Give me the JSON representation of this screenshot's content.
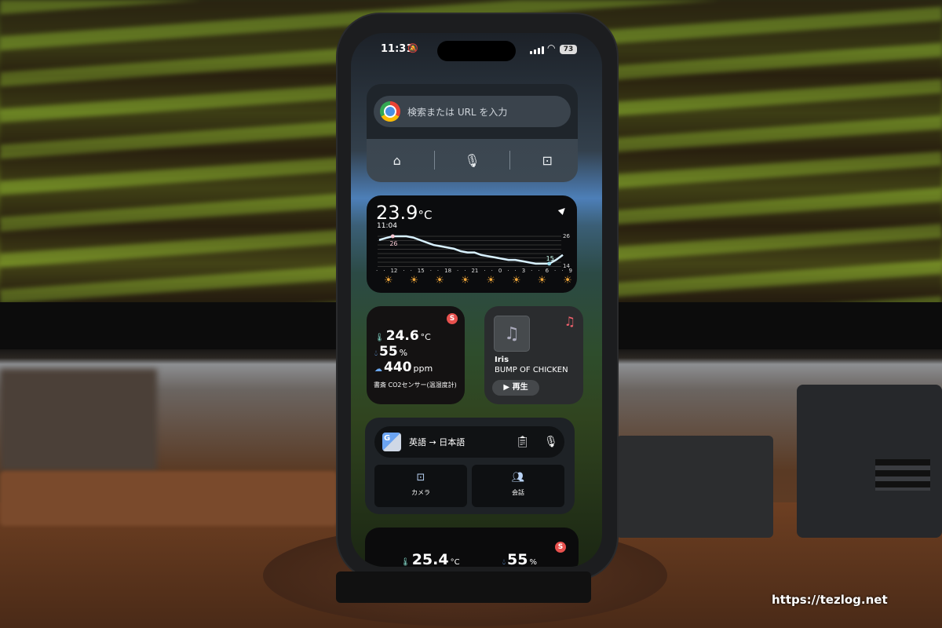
{
  "status_bar": {
    "time": "11:31",
    "battery": "73",
    "silent_icon": "bell-slash-icon"
  },
  "chrome_widget": {
    "search_placeholder": "検索または URL を入力",
    "actions": [
      "incognito-icon",
      "mic-icon",
      "lens-icon"
    ]
  },
  "weather_widget": {
    "temperature": "23.9",
    "unit": "°C",
    "updated": "11:04",
    "high_label": "26",
    "low_label": "15",
    "scale_max": "26",
    "scale_min": "14",
    "hour_labels": [
      "12",
      "15",
      "18",
      "21",
      "0",
      "3",
      "6",
      "9"
    ],
    "hourly_temps": [
      24.5,
      25.3,
      26,
      26,
      26,
      25.5,
      24.5,
      23.5,
      22.5,
      22,
      21.5,
      21,
      20,
      19.5,
      19.5,
      18.5,
      18,
      17.5,
      17,
      16.5,
      16.5,
      16,
      15.5,
      15,
      15,
      15,
      16.5,
      18.5
    ],
    "condition_icon": "sun-icon",
    "sun_color": "#f4a93a"
  },
  "sensor_widget": {
    "temperature": "24.6",
    "temp_unit": "°C",
    "humidity": "55",
    "humidity_unit": "%",
    "co2": "440",
    "co2_unit": "ppm",
    "name": "書斎 CO2センサー(温湿度計)",
    "badge": "S",
    "badge_color": "#e8514e"
  },
  "music_widget": {
    "title": "Iris",
    "artist": "BUMP OF CHICKEN",
    "play_label": "再生",
    "accent": "#f0616d"
  },
  "translate_widget": {
    "languages": "英語 → 日本語",
    "camera_label": "カメラ",
    "conversation_label": "会話"
  },
  "sensor_widget_2": {
    "temperature": "25.4",
    "temp_unit": "°C",
    "humidity": "55",
    "humidity_unit": "%",
    "badge": "S"
  },
  "watermark": "https://tezlog.net"
}
